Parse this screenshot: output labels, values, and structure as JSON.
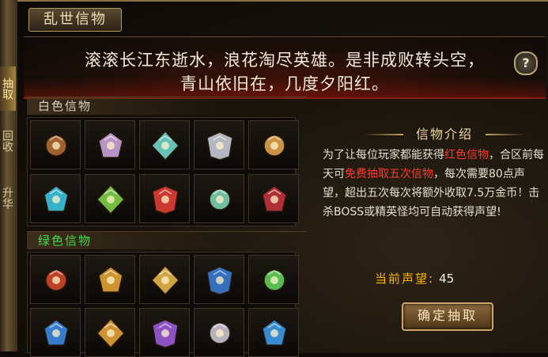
{
  "side_tabs": [
    {
      "label": "抽取",
      "active": true
    },
    {
      "label": "回收",
      "active": false
    },
    {
      "label": "升华",
      "active": false
    }
  ],
  "window": {
    "title": "乱世信物"
  },
  "poem": {
    "line1": "滚滚长江东逝水，浪花淘尽英雄。是非成败转头空，",
    "line2": "青山依旧在，几度夕阳红。"
  },
  "help_icon": "question-mark-icon",
  "sections": {
    "white": {
      "label": "白色信物",
      "items": [
        {
          "icon": "bronze-medallion-icon",
          "color": "#b06a32"
        },
        {
          "icon": "silver-spiked-crest-icon",
          "color": "#c9a3d8"
        },
        {
          "icon": "teal-crown-emblem-icon",
          "color": "#6fd6c8"
        },
        {
          "icon": "silver-shield-crest-icon",
          "color": "#c6c9d6"
        },
        {
          "icon": "gold-wing-emblem-icon",
          "color": "#e0a24a"
        },
        {
          "icon": "cyan-orb-talisman-icon",
          "color": "#3bc3e0"
        },
        {
          "icon": "jade-blade-charm-icon",
          "color": "#7fd04a"
        },
        {
          "icon": "red-diamond-emblem-icon",
          "color": "#e03c36"
        },
        {
          "icon": "rainbow-feather-crest-icon",
          "color": "#7bd0b0"
        },
        {
          "icon": "crimson-horned-mask-icon",
          "color": "#c0333a"
        }
      ]
    },
    "green": {
      "label": "绿色信物",
      "items": [
        {
          "icon": "ember-horned-helm-icon",
          "color": "#d0462a"
        },
        {
          "icon": "golden-spiked-orb-icon",
          "color": "#e3a334"
        },
        {
          "icon": "gold-winged-crown-icon",
          "color": "#e6b54a"
        },
        {
          "icon": "blue-gem-tablet-icon",
          "color": "#3a7ad0"
        },
        {
          "icon": "emerald-wing-crest-icon",
          "color": "#5fd05a"
        },
        {
          "icon": "sapphire-orb-crest-icon",
          "color": "#3a8ae0"
        },
        {
          "icon": "royal-gold-crown-icon",
          "color": "#e0a234"
        },
        {
          "icon": "violet-flame-crest-icon",
          "color": "#9a5ad8"
        },
        {
          "icon": "silver-winged-blade-icon",
          "color": "#c9c3d0"
        },
        {
          "icon": "azure-crystal-bloom-icon",
          "color": "#3a9ae6"
        }
      ]
    }
  },
  "info": {
    "title": "信物介绍",
    "text_1": "为了让每位玩家都能获得",
    "text_red_1": "红色信物",
    "text_2": "，合区前每天可",
    "text_red_2": "免费抽取五次信物",
    "text_3": "，每次需要80点声望，超出五次每次将额外收取7.5万金币！击杀BOSS或精英怪均可自动获得声望!",
    "reputation_label": "当前声望:",
    "reputation_value": "45",
    "confirm_label": "确定抽取"
  },
  "colors": {
    "red_highlight": "#ff3a2e",
    "green_section": "#49d74e",
    "reputation": "#ffb400"
  }
}
